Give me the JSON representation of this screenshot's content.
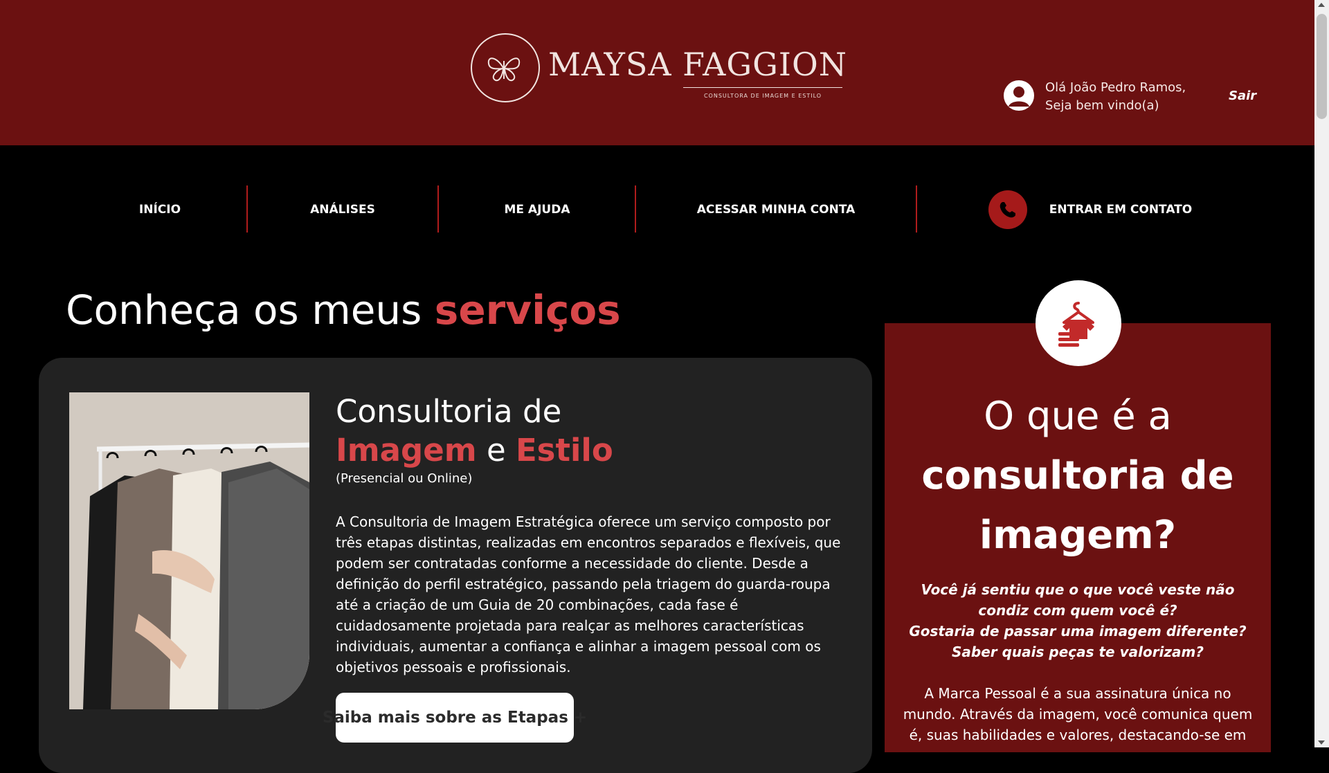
{
  "header": {
    "logo_name": "MAYSA FAGGION",
    "logo_tagline": "CONSULTORA DE IMAGEM E ESTILO",
    "greeting_line1": "Olá João Pedro Ramos,",
    "greeting_line2": "Seja bem vindo(a)",
    "logout_label": "Sair",
    "user_icon": "user-avatar-icon"
  },
  "nav": {
    "items": [
      {
        "label": "INÍCIO"
      },
      {
        "label": "ANÁLISES"
      },
      {
        "label": "ME AJUDA"
      },
      {
        "label": "ACESSAR MINHA CONTA"
      },
      {
        "label": "ENTRAR EM CONTATO",
        "icon": "whatsapp-icon"
      }
    ]
  },
  "services": {
    "heading_prefix": "Conheça os meus",
    "heading_accent": "serviços",
    "card": {
      "title_line1": "Consultoria de",
      "title_accent1": "Imagem",
      "title_connector": "e",
      "title_accent2": "Estilo",
      "subtitle": "(Presencial ou Online)",
      "body": "A Consultoria de Imagem Estratégica oferece um serviço composto por três etapas distintas, realizadas em encontros separados e flexíveis, que podem ser contratadas conforme a necessidade do cliente. Desde a definição do perfil estratégico, passando pela triagem do guarda-roupa até a criação de um Guia de 20 combinações, cada fase é cuidadosamente projetada para realçar as melhores características individuais, aumentar a confiança e alinhar a imagem pessoal com os objetivos pessoais e profissionais.",
      "button_label": "Saiba mais sobre as Etapas +",
      "photo": "clothes-rack-photo"
    }
  },
  "panel": {
    "badge_icon": "clothes-hanger-icon",
    "title_line1": "O que é a",
    "title_line2": "consultoria de",
    "title_line3": "imagem?",
    "question1": "Você já sentiu que o que você veste não condiz com quem você é?",
    "question2": "Gostaria de passar uma imagem diferente? Saber quais peças te valorizam?",
    "text": "A Marca Pessoal é a sua assinatura única no mundo. Através da imagem, você comunica quem é, suas habilidades e valores, destacando-se em"
  },
  "colors": {
    "header_bg": "#6b1111",
    "accent_red": "#d8474a",
    "card_bg": "#222222",
    "nav_separator": "#b01c1c"
  }
}
